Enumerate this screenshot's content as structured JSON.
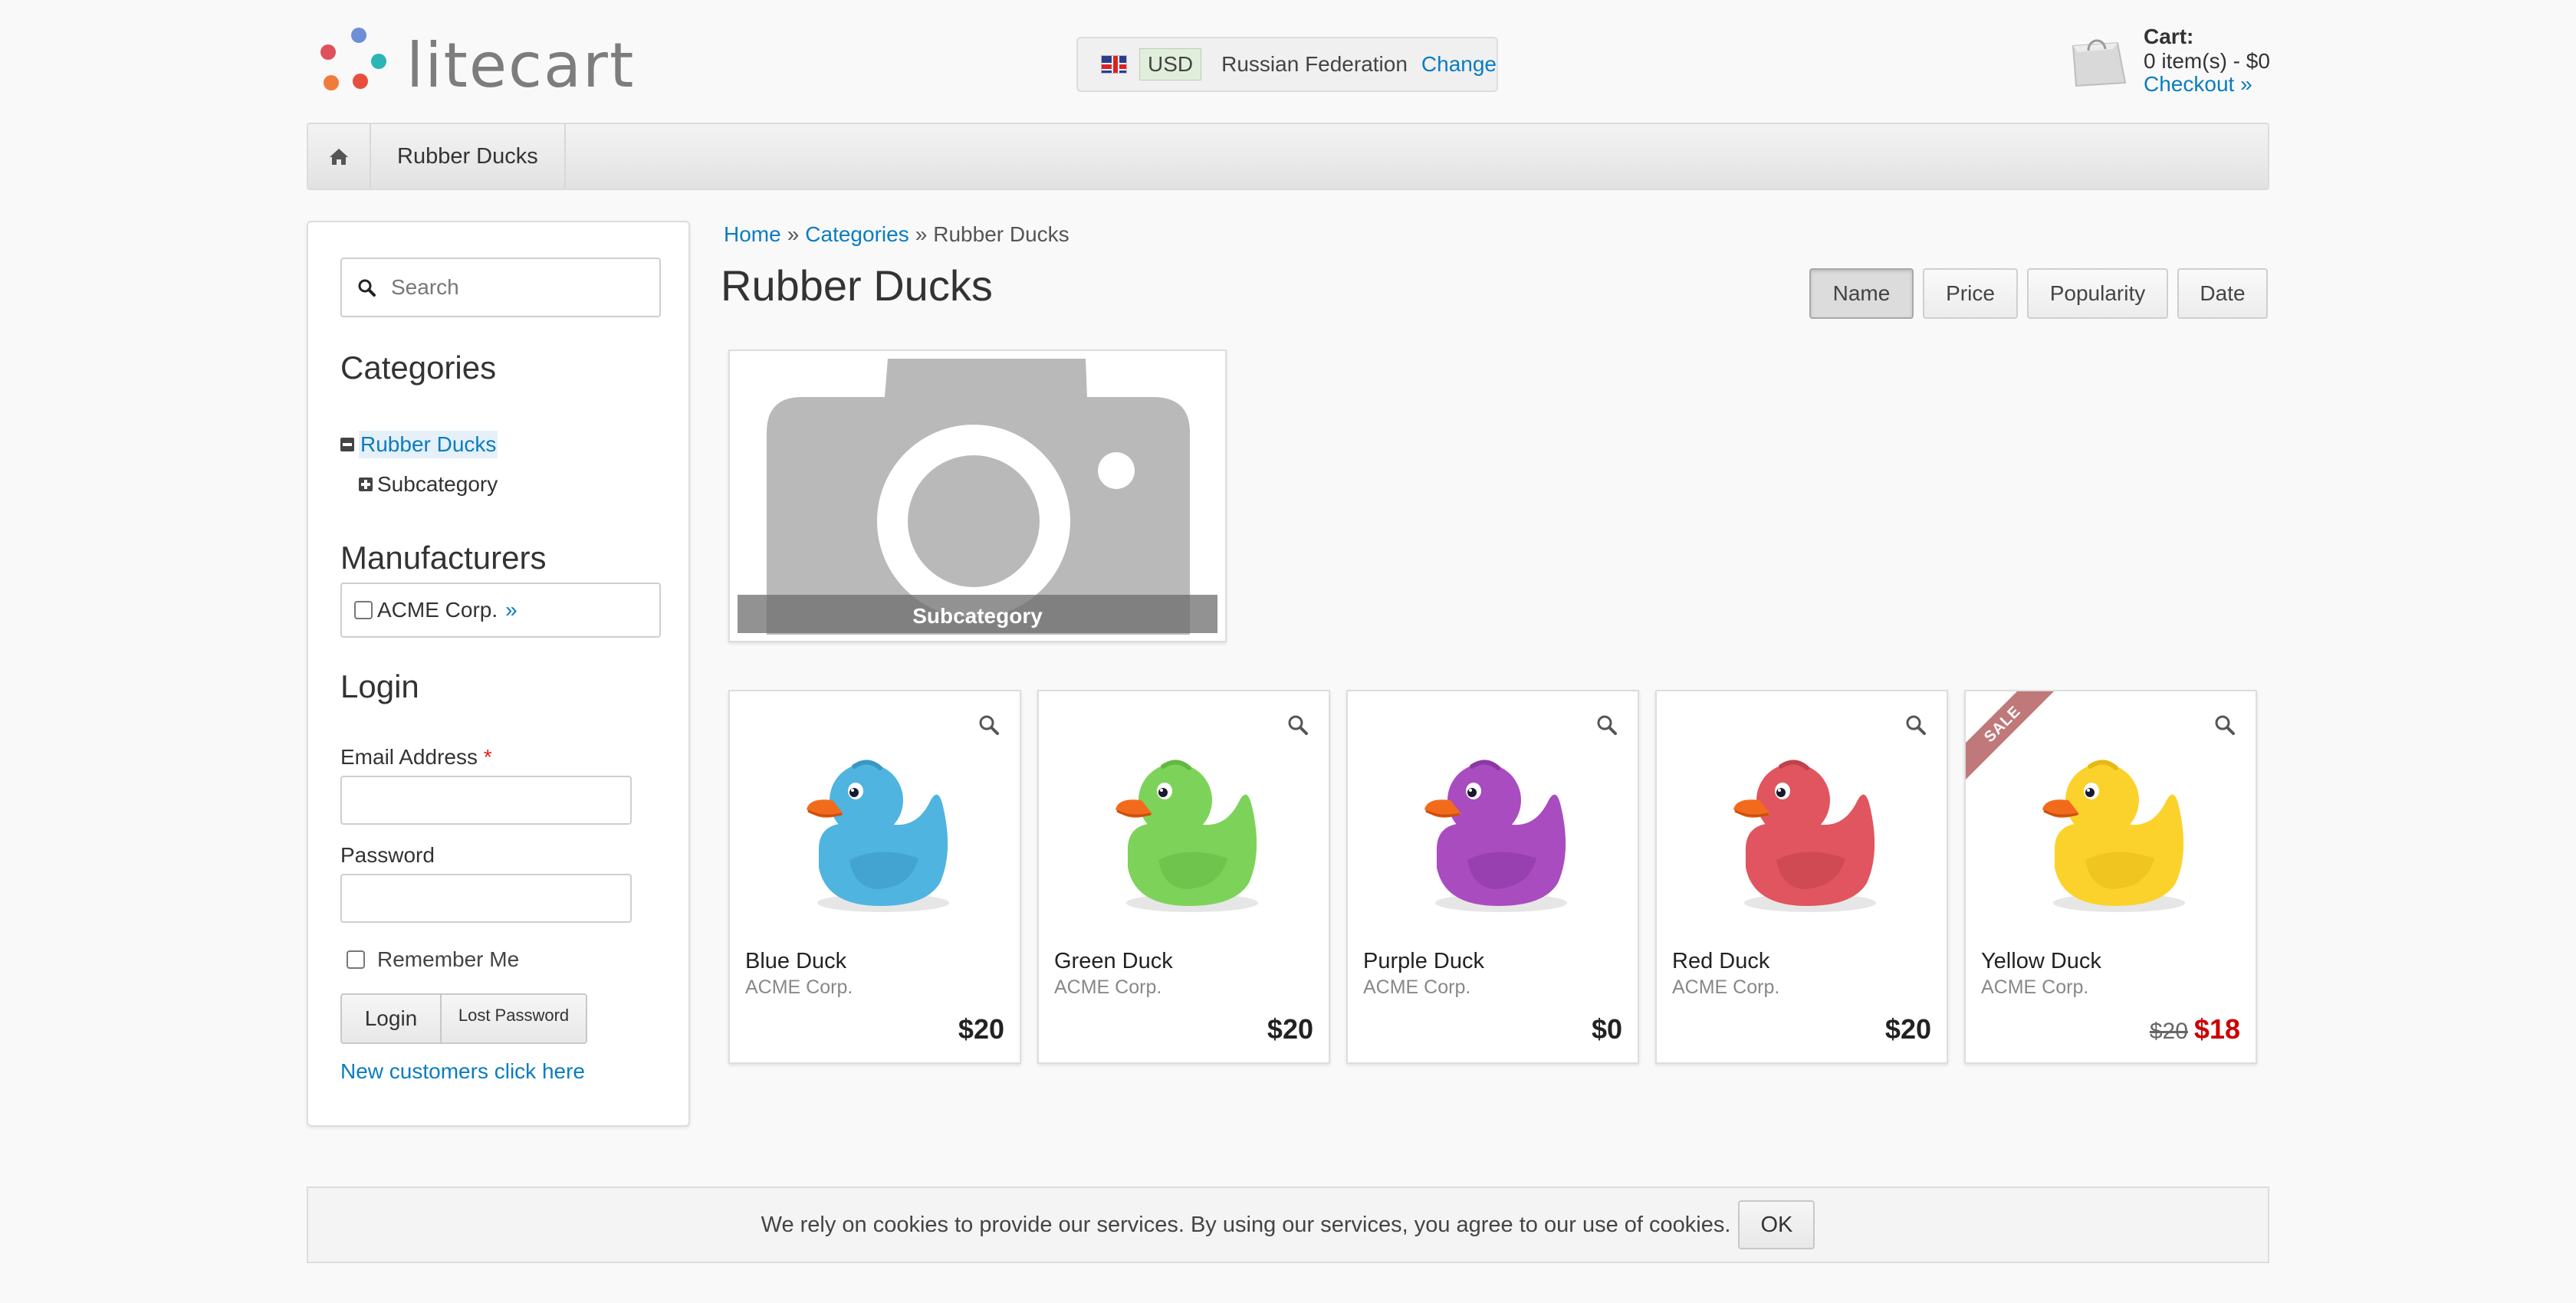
{
  "header": {
    "logo_text": "litecart",
    "region": {
      "currency": "USD",
      "country": "Russian Federation",
      "change_label": "Change"
    },
    "cart": {
      "title": "Cart:",
      "summary": "0 item(s) - $0",
      "checkout_label": "Checkout »"
    }
  },
  "nav": {
    "items": [
      {
        "label": "Rubber Ducks"
      }
    ]
  },
  "sidebar": {
    "search_placeholder": "Search",
    "categories_heading": "Categories",
    "categories": [
      {
        "label": "Rubber Ducks",
        "active": true
      },
      {
        "label": "Subcategory",
        "active": false
      }
    ],
    "manufacturers_heading": "Manufacturers",
    "manufacturers": [
      {
        "label": "ACME Corp.",
        "link": "»"
      }
    ],
    "login": {
      "heading": "Login",
      "email_label": "Email Address",
      "required_mark": "*",
      "password_label": "Password",
      "remember_label": "Remember Me",
      "login_button": "Login",
      "lost_password_button": "Lost Password",
      "new_customers_link": "New customers click here"
    }
  },
  "main": {
    "breadcrumb": [
      "Home",
      "Categories",
      "Rubber Ducks"
    ],
    "breadcrumb_sep": "»",
    "title": "Rubber Ducks",
    "sort_options": [
      "Name",
      "Price",
      "Popularity",
      "Date"
    ],
    "sort_active": "Name",
    "subcategory": {
      "caption": "Subcategory"
    },
    "products": [
      {
        "name": "Blue Duck",
        "manufacturer": "ACME Corp.",
        "price": "$20",
        "color": "#4fb4e0",
        "shade": "#3a98c4"
      },
      {
        "name": "Green Duck",
        "manufacturer": "ACME Corp.",
        "price": "$20",
        "color": "#7dd35a",
        "shade": "#62b843"
      },
      {
        "name": "Purple Duck",
        "manufacturer": "ACME Corp.",
        "price": "$0",
        "color": "#a94cc0",
        "shade": "#8c37a3"
      },
      {
        "name": "Red Duck",
        "manufacturer": "ACME Corp.",
        "price": "$20",
        "color": "#e0555f",
        "shade": "#c2414b"
      },
      {
        "name": "Yellow Duck",
        "manufacturer": "ACME Corp.",
        "old_price": "$20",
        "price": "$18",
        "sale": "SALE",
        "color": "#fbd22c",
        "shade": "#e7b915"
      }
    ]
  },
  "cookie": {
    "text": "We rely on cookies to provide our services. By using our services, you agree to our use of cookies.",
    "ok_label": "OK"
  },
  "colors": {
    "link": "#0a7cc1",
    "sale_price": "#cc0000",
    "sale_ribbon": "#c0797a"
  }
}
